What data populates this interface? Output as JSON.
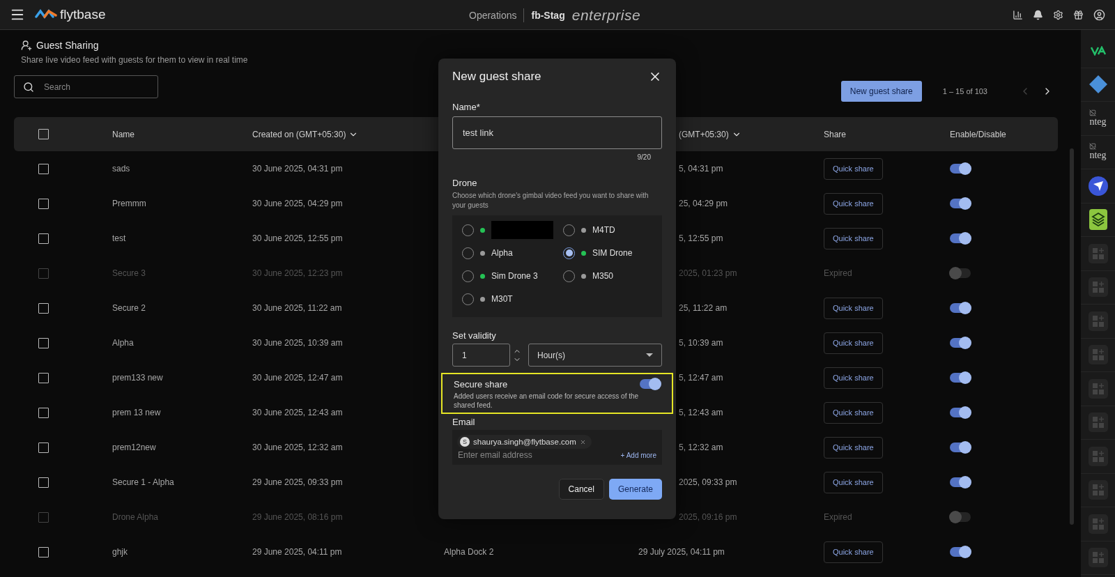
{
  "top_bar": {
    "brand": "flytbase",
    "nav": "Operations",
    "org": "fb-Stag",
    "plan": "enterprise"
  },
  "page": {
    "title": "Guest Sharing",
    "subtitle": "Share live video feed with guests for them to view in real time",
    "search": {
      "placeholder": "Search"
    },
    "new_button": "New guest share",
    "pagination": "1 – 15 of 103"
  },
  "table": {
    "select_all_checked": false,
    "columns": [
      {
        "label": "Name"
      },
      {
        "label": "Created on (GMT+05:30)",
        "sortable": true
      },
      {
        "label": "(GMT+05:30)",
        "sortable": true
      },
      {
        "label": "Share"
      },
      {
        "label": "Enable/Disable"
      }
    ],
    "rows": [
      {
        "checked": false,
        "name": "sads",
        "created": "30 June 2025, 04:31 pm",
        "column_4": "5, 04:31 pm",
        "share": "Quick share",
        "expired": false,
        "enabled": true
      },
      {
        "checked": false,
        "name": "Premmm",
        "created": "30 June 2025, 04:29 pm",
        "column_4": "25, 04:29 pm",
        "share": "Quick share",
        "expired": false,
        "enabled": true
      },
      {
        "checked": false,
        "name": "test",
        "created": "30 June 2025, 12:55 pm",
        "column_4": "5, 12:55 pm",
        "share": "Quick share",
        "expired": false,
        "enabled": true
      },
      {
        "checked": false,
        "name": "Secure 3",
        "created": "30 June 2025, 12:23 pm",
        "column_4": "2025, 01:23 pm",
        "share": "Expired",
        "expired": true,
        "enabled": false
      },
      {
        "checked": false,
        "name": "Secure 2",
        "created": "30 June 2025, 11:22 am",
        "column_4": "25, 11:22 am",
        "share": "Quick share",
        "expired": false,
        "enabled": true
      },
      {
        "checked": false,
        "name": "Alpha",
        "created": "30 June 2025, 10:39 am",
        "column_4": "5, 10:39 am",
        "share": "Quick share",
        "expired": false,
        "enabled": true
      },
      {
        "checked": false,
        "name": "prem133 new",
        "created": "30 June 2025, 12:47 am",
        "column_4": "5, 12:47 am",
        "share": "Quick share",
        "expired": false,
        "enabled": true
      },
      {
        "checked": false,
        "name": "prem 13 new",
        "created": "30 June 2025, 12:43 am",
        "column_4": "5, 12:43 am",
        "share": "Quick share",
        "expired": false,
        "enabled": true
      },
      {
        "checked": false,
        "name": "prem12new",
        "created": "30 June 2025, 12:32 am",
        "column_4": "5, 12:32 am",
        "share": "Quick share",
        "expired": false,
        "enabled": true
      },
      {
        "checked": false,
        "name": "Secure 1 - Alpha",
        "created": "29 June 2025, 09:33 pm",
        "column_4": "2025, 09:33 pm",
        "share": "Quick share",
        "expired": false,
        "enabled": true
      },
      {
        "checked": false,
        "name": "Drone Alpha",
        "created": "29 June 2025, 08:16 pm",
        "column_4": "2025, 09:16 pm",
        "share": "Expired",
        "expired": true,
        "enabled": false
      },
      {
        "checked": false,
        "name": "ghjk",
        "created": "29 June 2025, 04:11 pm",
        "column_3": "Alpha Dock 2",
        "column_4": "29 July 2025, 04:11 pm",
        "share": "Quick share",
        "expired": false,
        "enabled": true
      }
    ]
  },
  "modal": {
    "title": "New guest share",
    "name_label": "Name*",
    "name_value": "test link",
    "counter": "9/20",
    "drone_label": "Drone",
    "drone_hint": "Choose which drone's gimbal video feed you want to share with your guests",
    "drones": [
      {
        "kind": "redacted",
        "online": true,
        "selected": false
      },
      {
        "kind": "named",
        "name": "M4TD",
        "online": false,
        "selected": false
      },
      {
        "kind": "named",
        "name": "Alpha",
        "online": false,
        "selected": false
      },
      {
        "kind": "named",
        "name": "SIM Drone",
        "online": true,
        "selected": true
      },
      {
        "kind": "named",
        "name": "Sim Drone 3",
        "online": true,
        "selected": false
      },
      {
        "kind": "named",
        "name": "M350",
        "online": false,
        "selected": false
      },
      {
        "kind": "named",
        "name": "M30T",
        "online": false,
        "selected": false
      }
    ],
    "validity_label": "Set validity",
    "validity_value": "1",
    "validity_unit": "Hour(s)",
    "secure": {
      "title": "Secure share",
      "description": "Added users receive an email code for secure access of the shared feed.",
      "on": true,
      "highlighted": true
    },
    "email_label": "Email",
    "emails": [
      {
        "initial": "S",
        "address": "shaurya.singh@flytbase.com"
      }
    ],
    "email_placeholder": "Enter email address",
    "add_more": "+ Add more",
    "cancel": "Cancel",
    "generate": "Generate"
  },
  "dock": [
    {
      "kind": "va"
    },
    {
      "kind": "diamond"
    },
    {
      "kind": "broken",
      "text": "nteg"
    },
    {
      "kind": "broken",
      "text": "nteg"
    },
    {
      "kind": "send"
    },
    {
      "kind": "layers"
    },
    {
      "kind": "slot"
    },
    {
      "kind": "slot"
    },
    {
      "kind": "slot"
    },
    {
      "kind": "slot"
    },
    {
      "kind": "slot"
    },
    {
      "kind": "slot"
    },
    {
      "kind": "slot"
    },
    {
      "kind": "slot"
    },
    {
      "kind": "slot"
    },
    {
      "kind": "slot"
    }
  ]
}
